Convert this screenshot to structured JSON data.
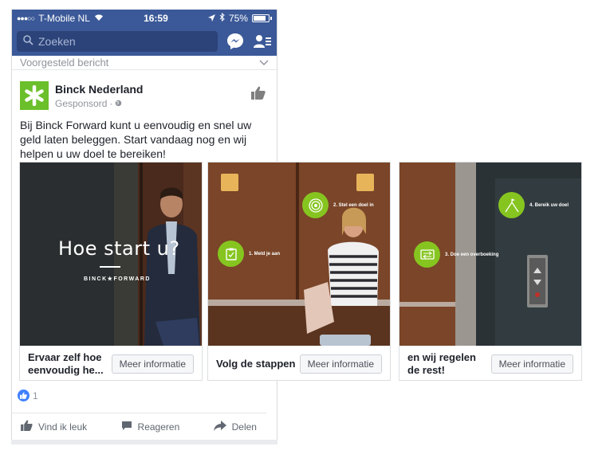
{
  "status_bar": {
    "signal": "●●●○○",
    "carrier": "T-Mobile NL",
    "time": "16:59",
    "battery_pct": "75%"
  },
  "navbar": {
    "search_placeholder": "Zoeken"
  },
  "feed": {
    "suggested_label": "Voorgesteld bericht"
  },
  "post": {
    "page_name": "Binck Nederland",
    "sponsored_label": "Gesponsord",
    "separator": "·",
    "text": "Bij Binck Forward kunt u eenvoudig en snel uw geld laten beleggen. Start vandaag nog en wij helpen u uw doel te bereiken!",
    "brand_color": "#6bbf2a",
    "reaction_count": "1"
  },
  "carousel": [
    {
      "overlay_title": "Hoe start u?",
      "overlay_brand": "BINCK★FORWARD",
      "headline": "Ervaar zelf hoe eenvoudig he...",
      "cta": "Meer informatie"
    },
    {
      "steps": [
        "1. Meld je aan",
        "2. Stel een doel in"
      ],
      "headline": "Volg de stappen",
      "cta": "Meer informatie"
    },
    {
      "steps": [
        "3. Doe een overboeking",
        "4. Bereik uw doel"
      ],
      "headline": "en wij regelen de rest!",
      "cta": "Meer informatie"
    }
  ],
  "actions": {
    "like": "Vind ik leuk",
    "comment": "Reageren",
    "share": "Delen"
  },
  "colors": {
    "facebook_blue": "#3b5998",
    "step_green": "#86c520"
  }
}
